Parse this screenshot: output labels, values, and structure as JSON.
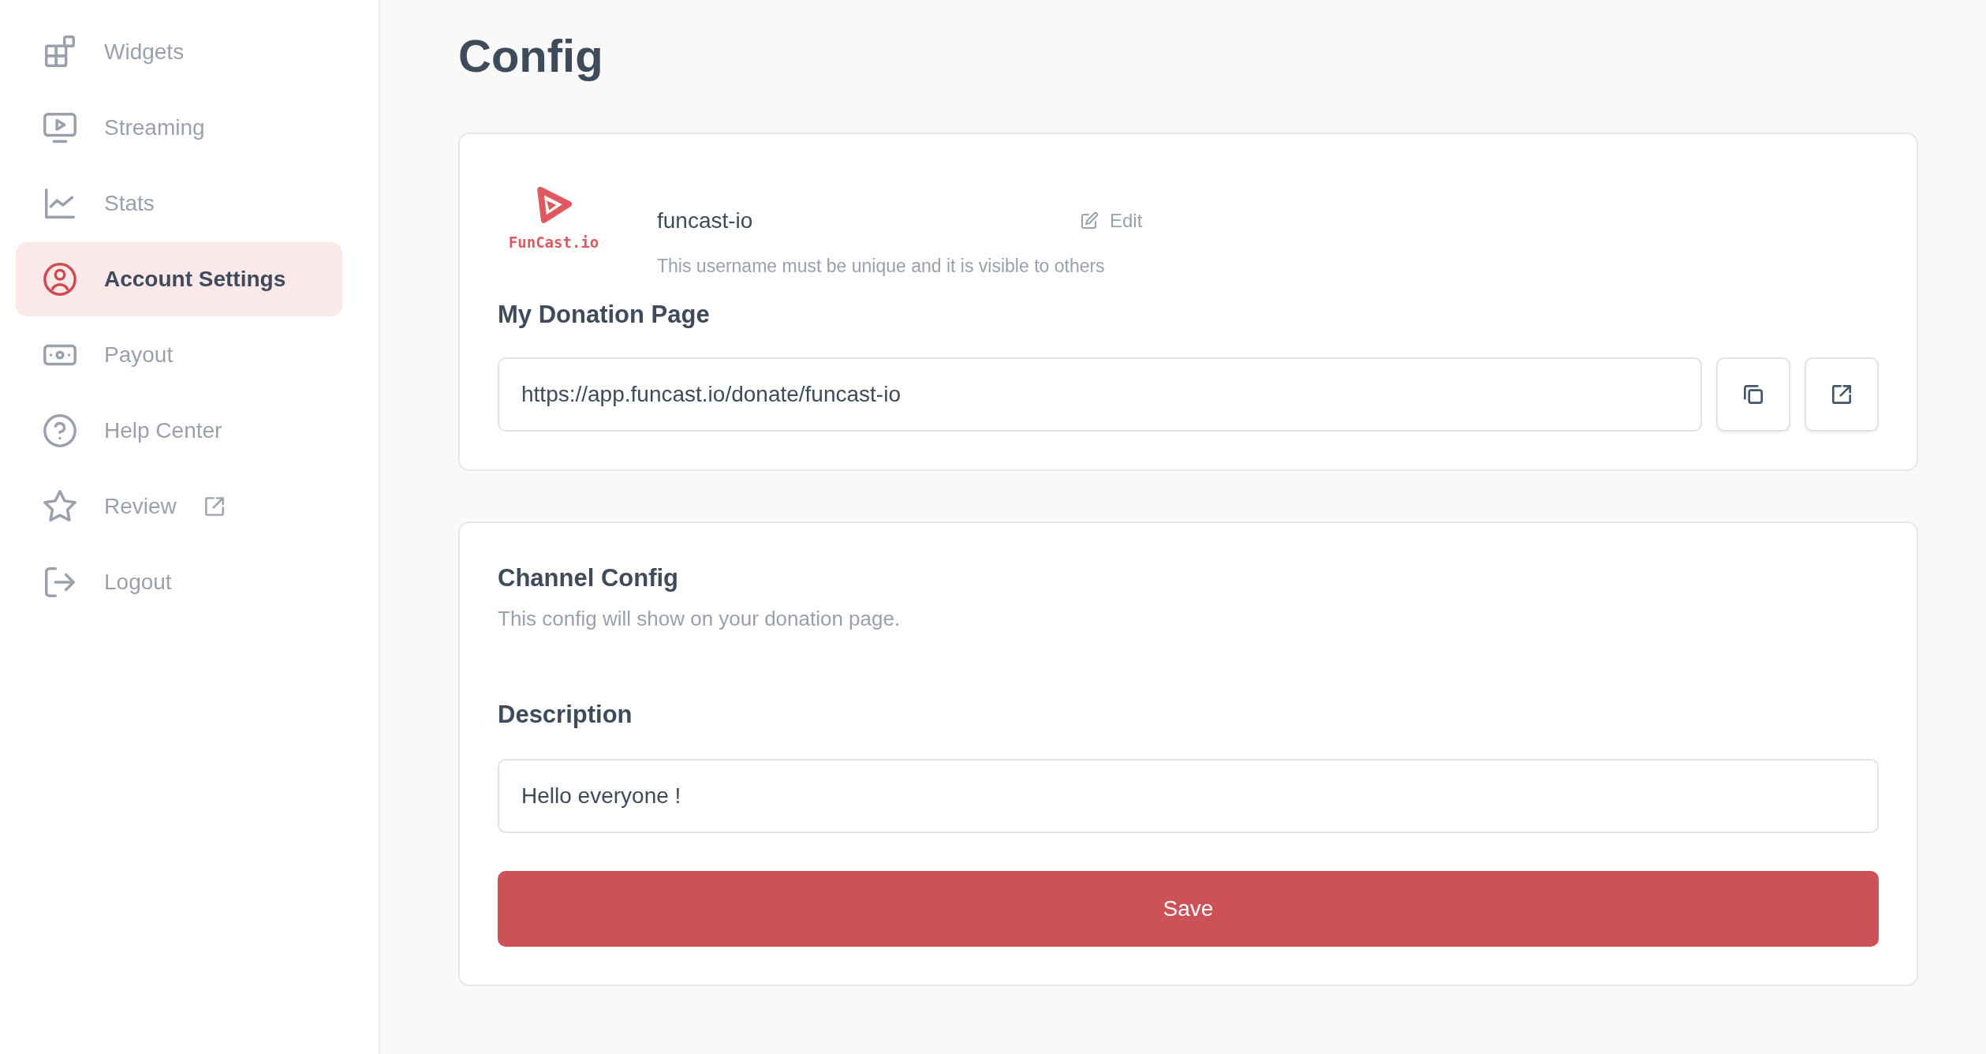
{
  "sidebar": {
    "items": [
      {
        "label": "Widgets",
        "selected": false,
        "external": false
      },
      {
        "label": "Streaming",
        "selected": false,
        "external": false
      },
      {
        "label": "Stats",
        "selected": false,
        "external": false
      },
      {
        "label": "Account Settings",
        "selected": true,
        "external": false
      },
      {
        "label": "Payout",
        "selected": false,
        "external": false
      },
      {
        "label": "Help Center",
        "selected": false,
        "external": false
      },
      {
        "label": "Review",
        "selected": false,
        "external": true
      },
      {
        "label": "Logout",
        "selected": false,
        "external": false
      }
    ]
  },
  "page": {
    "title": "Config"
  },
  "profile": {
    "logo_text": "FunCast.io",
    "username": "funcast-io",
    "edit_label": "Edit",
    "hint": "This username must be unique and it is visible to others",
    "donation_heading": "My Donation Page",
    "donation_url": "https://app.funcast.io/donate/funcast-io"
  },
  "channel": {
    "title": "Channel Config",
    "subtitle": "This config will show on your donation page.",
    "description_label": "Description",
    "description_value": "Hello everyone !",
    "save_label": "Save"
  }
}
